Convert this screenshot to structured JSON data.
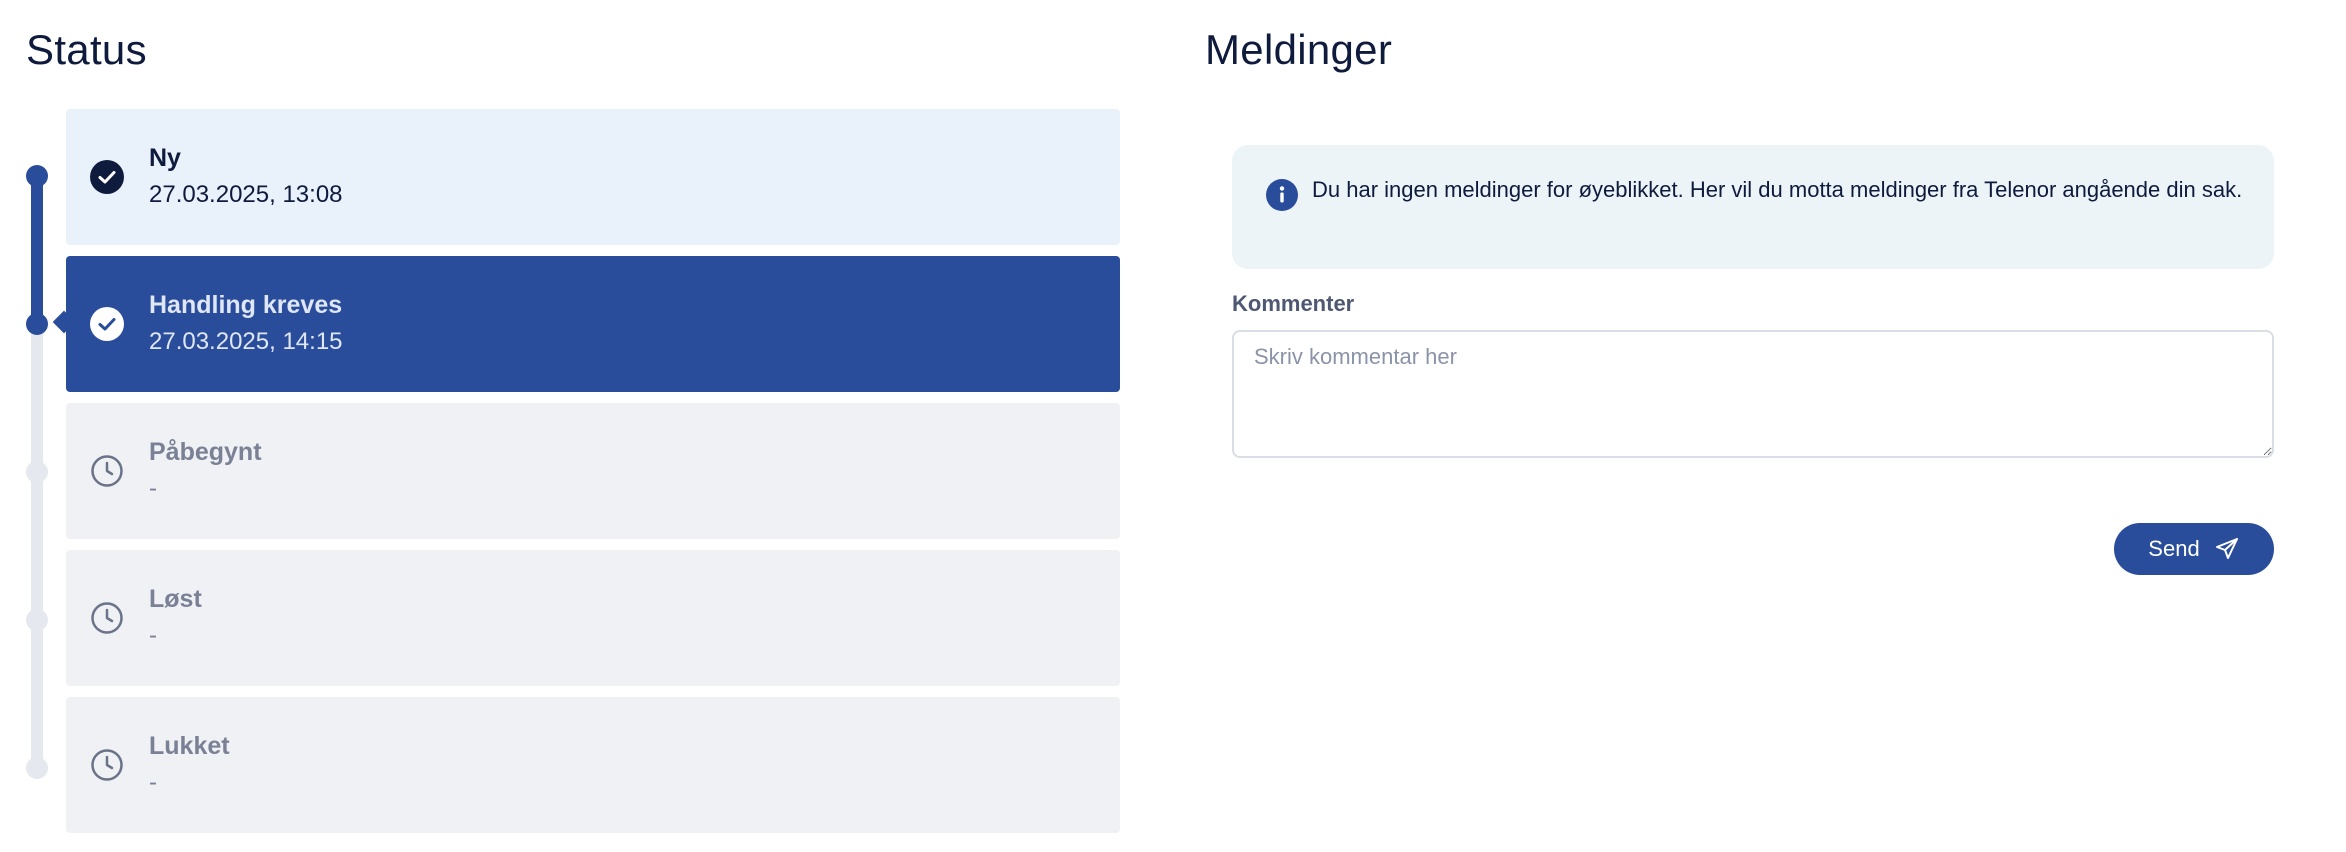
{
  "status": {
    "title": "Status",
    "steps": [
      {
        "label": "Ny",
        "date": "27.03.2025, 13:08",
        "state": "done",
        "icon": "check-circle-icon"
      },
      {
        "label": "Handling kreves",
        "date": "27.03.2025, 14:15",
        "state": "active",
        "icon": "check-circle-icon"
      },
      {
        "label": "Påbegynt",
        "date": "-",
        "state": "pending",
        "icon": "clock-icon"
      },
      {
        "label": "Løst",
        "date": "-",
        "state": "pending",
        "icon": "clock-icon"
      },
      {
        "label": "Lukket",
        "date": "-",
        "state": "pending",
        "icon": "clock-icon"
      }
    ]
  },
  "messages": {
    "title": "Meldinger",
    "info_text": "Du har ingen meldinger for øyeblikket. Her vil du motta meldinger fra Telenor angående din sak.",
    "info_icon": "info-icon",
    "comment_label": "Kommenter",
    "comment_placeholder": "Skriv kommentar her",
    "comment_value": "",
    "send_label": "Send",
    "send_icon": "send-icon"
  },
  "colors": {
    "primary": "#2a4d9b",
    "text_dark": "#0f1b3d",
    "pending_card": "#eff1f5",
    "first_card": "#e9f1fb",
    "info_bg": "#ecf4f8",
    "track": "#e5e8ef"
  }
}
